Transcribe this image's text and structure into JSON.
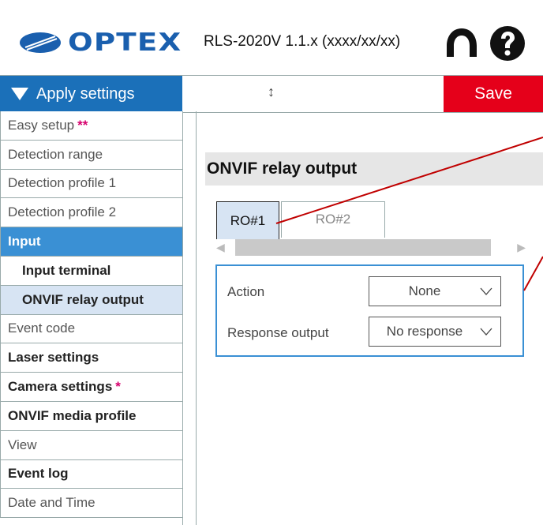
{
  "header": {
    "logo_text": "OPTEX",
    "version": "RLS-2020V 1.1.x (xxxx/xx/xx)"
  },
  "toolbar": {
    "apply_label": "Apply settings",
    "resize_glyph": "↕",
    "save_label": "Save"
  },
  "sidebar": {
    "items": [
      {
        "label": "Easy setup",
        "stars": "**"
      },
      {
        "label": "Detection range"
      },
      {
        "label": "Detection profile 1"
      },
      {
        "label": "Detection profile 2"
      },
      {
        "label": "Input"
      },
      {
        "label": "Input terminal"
      },
      {
        "label": "ONVIF relay output"
      },
      {
        "label": "Event code"
      },
      {
        "label": "Laser settings"
      },
      {
        "label": "Camera settings",
        "stars": "*"
      },
      {
        "label": "ONVIF media profile"
      },
      {
        "label": "View"
      },
      {
        "label": "Event log"
      },
      {
        "label": "Date and Time"
      }
    ]
  },
  "main": {
    "title": "ONVIF relay output",
    "tabs": [
      {
        "label": "RO#1",
        "selected": true
      },
      {
        "label": "RO#2",
        "selected": false
      }
    ],
    "fields": {
      "action_label": "Action",
      "action_value": "None",
      "response_label": "Response output",
      "response_value": "No response"
    }
  },
  "colors": {
    "brand_blue": "#1a5fae",
    "apply_blue": "#1b70b9",
    "active_blue": "#3a90d4",
    "selected_bg": "#d7e4f3",
    "save_red": "#e5001a",
    "callout_red": "#c00000"
  }
}
